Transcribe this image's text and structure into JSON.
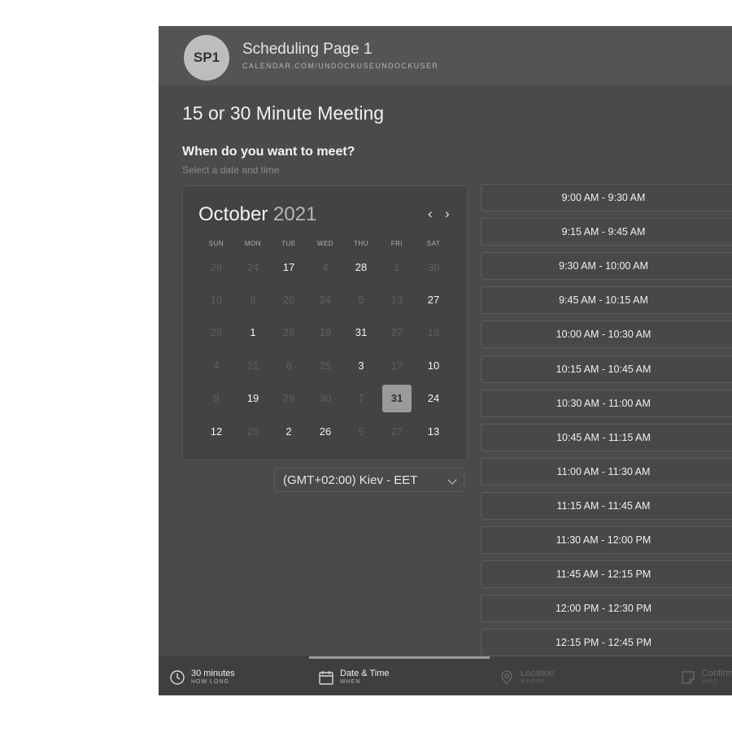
{
  "header": {
    "avatar_initials": "SP1",
    "page_name": "Scheduling Page 1",
    "page_url": "CALENDAR.COM/UNDOCKUSEUNDOCKUSER"
  },
  "meeting": {
    "title": "15 or 30 Minute Meeting",
    "question": "When do you want to meet?",
    "instruction": "Select a date and time"
  },
  "calendar": {
    "month": "October",
    "year": "2021",
    "prev_icon": "‹",
    "next_icon": "›",
    "weekdays": [
      "SUN",
      "MON",
      "TUE",
      "WED",
      "THU",
      "FRI",
      "SAT"
    ],
    "weeks": [
      [
        {
          "d": "28",
          "a": false
        },
        {
          "d": "24",
          "a": false
        },
        {
          "d": "17",
          "a": true
        },
        {
          "d": "4",
          "a": false
        },
        {
          "d": "28",
          "a": true
        },
        {
          "d": "1",
          "a": false
        },
        {
          "d": "30",
          "a": false
        }
      ],
      [
        {
          "d": "10",
          "a": false
        },
        {
          "d": "8",
          "a": false
        },
        {
          "d": "26",
          "a": false
        },
        {
          "d": "24",
          "a": false
        },
        {
          "d": "5",
          "a": false
        },
        {
          "d": "13",
          "a": false
        },
        {
          "d": "27",
          "a": true
        }
      ],
      [
        {
          "d": "28",
          "a": false
        },
        {
          "d": "1",
          "a": true
        },
        {
          "d": "29",
          "a": false
        },
        {
          "d": "19",
          "a": false
        },
        {
          "d": "31",
          "a": true
        },
        {
          "d": "27",
          "a": false
        },
        {
          "d": "18",
          "a": false
        }
      ],
      [
        {
          "d": "4",
          "a": false
        },
        {
          "d": "21",
          "a": false
        },
        {
          "d": "6",
          "a": false
        },
        {
          "d": "25",
          "a": false
        },
        {
          "d": "3",
          "a": true
        },
        {
          "d": "17",
          "a": false
        },
        {
          "d": "10",
          "a": true
        }
      ],
      [
        {
          "d": "9",
          "a": false
        },
        {
          "d": "19",
          "a": true
        },
        {
          "d": "29",
          "a": false
        },
        {
          "d": "30",
          "a": false
        },
        {
          "d": "7",
          "a": false
        },
        {
          "d": "31",
          "a": true,
          "selected": true
        },
        {
          "d": "24",
          "a": true
        }
      ],
      [
        {
          "d": "12",
          "a": true
        },
        {
          "d": "25",
          "a": false
        },
        {
          "d": "2",
          "a": true
        },
        {
          "d": "26",
          "a": true
        },
        {
          "d": "5",
          "a": false
        },
        {
          "d": "27",
          "a": false
        },
        {
          "d": "13",
          "a": true
        }
      ]
    ]
  },
  "timezone": {
    "value": "(GMT+02:00) Kiev - EET"
  },
  "slots": [
    "9:00 AM - 9:30 AM",
    "9:15 AM - 9:45 AM",
    "9:30 AM - 10:00 AM",
    "9:45 AM - 10:15 AM",
    "10:00 AM - 10:30 AM",
    "10:15 AM - 10:45 AM",
    "10:30 AM - 11:00 AM",
    "10:45 AM - 11:15 AM",
    "11:00 AM - 11:30 AM",
    "11:15 AM - 11:45 AM",
    "11:30 AM - 12:00 PM",
    "11:45 AM - 12:15 PM",
    "12:00 PM - 12:30 PM",
    "12:15 PM - 12:45 PM"
  ],
  "footer": {
    "steps": [
      {
        "title": "30 minutes",
        "sub": "HOW LONG",
        "icon": "clock-icon",
        "state": "done"
      },
      {
        "title": "Date & Time",
        "sub": "WHEN",
        "icon": "calendar-icon",
        "state": "active"
      },
      {
        "title": "Location",
        "sub": "WHERE",
        "icon": "location-pin-icon",
        "state": "inactive"
      },
      {
        "title": "Confirm",
        "sub": "WHO",
        "icon": "note-icon",
        "state": "inactive"
      }
    ]
  },
  "colors": {
    "background": "#4a4a4a",
    "header": "#545454",
    "selected_day": "#9a9a9a"
  }
}
